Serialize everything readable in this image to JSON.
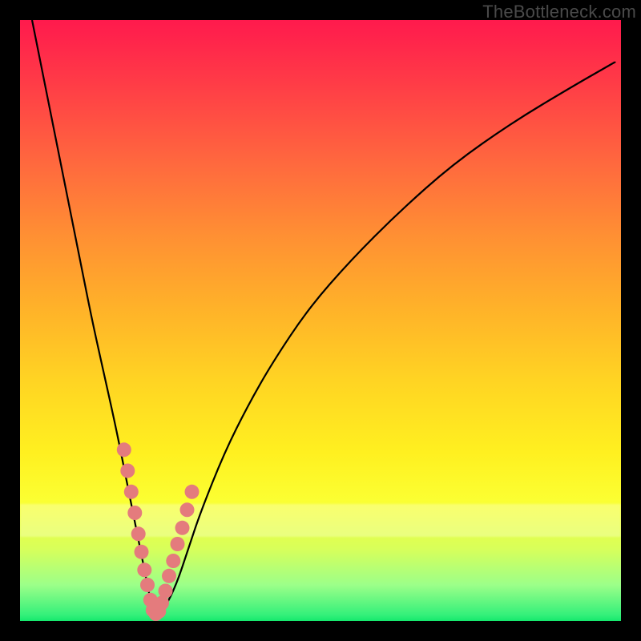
{
  "watermark": "TheBottleneck.com",
  "colors": {
    "curve_stroke": "#000000",
    "marker_fill": "#e47b7d",
    "marker_stroke": "#c2575b",
    "frame_bg": "#000000"
  },
  "chart_data": {
    "type": "line",
    "title": "",
    "xlabel": "",
    "ylabel": "",
    "xlim": [
      0,
      100
    ],
    "ylim": [
      0,
      100
    ],
    "grid": false,
    "legend": false,
    "note": "Axes are implied (no tick labels shown). y≈bottleneck percentage, V-shaped curve with minimum near x≈22.",
    "series": [
      {
        "name": "bottleneck-curve",
        "x": [
          2,
          4,
          6,
          8,
          10,
          12,
          14,
          16,
          18,
          20,
          21,
          22,
          23,
          24,
          26,
          28,
          30,
          34,
          38,
          42,
          48,
          55,
          63,
          72,
          82,
          92,
          99
        ],
        "y": [
          100,
          90,
          80,
          70,
          60,
          50,
          41,
          32,
          22,
          12,
          7,
          2,
          1,
          2,
          6,
          12,
          18,
          28,
          36,
          43,
          52,
          60,
          68,
          76,
          83,
          89,
          93
        ]
      }
    ],
    "markers": {
      "name": "highlighted-points",
      "x": [
        17.3,
        17.9,
        18.5,
        19.1,
        19.7,
        20.2,
        20.7,
        21.2,
        21.7,
        22.1,
        22.6,
        23.1,
        23.6,
        24.2,
        24.8,
        25.5,
        26.2,
        27.0,
        27.8,
        28.6
      ],
      "y": [
        28.5,
        25.0,
        21.5,
        18.0,
        14.5,
        11.5,
        8.5,
        6.0,
        3.5,
        1.8,
        1.2,
        1.6,
        3.0,
        5.0,
        7.5,
        10.0,
        12.8,
        15.5,
        18.5,
        21.5
      ]
    }
  }
}
